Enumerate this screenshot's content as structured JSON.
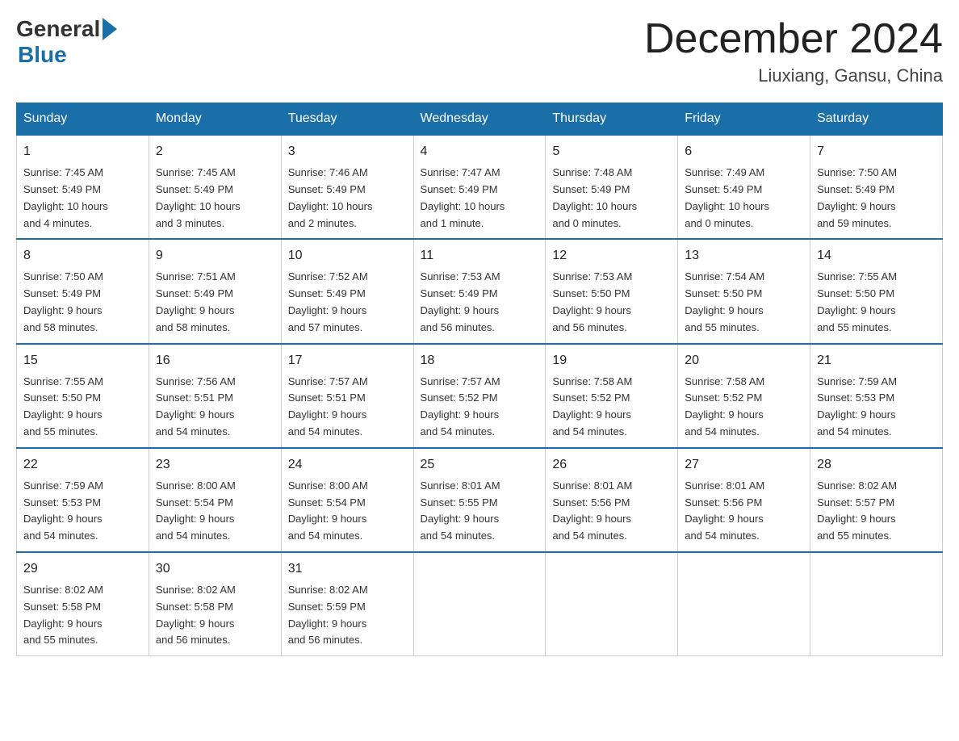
{
  "header": {
    "logo_general": "General",
    "logo_blue": "Blue",
    "month_title": "December 2024",
    "location": "Liuxiang, Gansu, China"
  },
  "weekdays": [
    "Sunday",
    "Monday",
    "Tuesday",
    "Wednesday",
    "Thursday",
    "Friday",
    "Saturday"
  ],
  "weeks": [
    [
      {
        "day": "1",
        "info": "Sunrise: 7:45 AM\nSunset: 5:49 PM\nDaylight: 10 hours\nand 4 minutes."
      },
      {
        "day": "2",
        "info": "Sunrise: 7:45 AM\nSunset: 5:49 PM\nDaylight: 10 hours\nand 3 minutes."
      },
      {
        "day": "3",
        "info": "Sunrise: 7:46 AM\nSunset: 5:49 PM\nDaylight: 10 hours\nand 2 minutes."
      },
      {
        "day": "4",
        "info": "Sunrise: 7:47 AM\nSunset: 5:49 PM\nDaylight: 10 hours\nand 1 minute."
      },
      {
        "day": "5",
        "info": "Sunrise: 7:48 AM\nSunset: 5:49 PM\nDaylight: 10 hours\nand 0 minutes."
      },
      {
        "day": "6",
        "info": "Sunrise: 7:49 AM\nSunset: 5:49 PM\nDaylight: 10 hours\nand 0 minutes."
      },
      {
        "day": "7",
        "info": "Sunrise: 7:50 AM\nSunset: 5:49 PM\nDaylight: 9 hours\nand 59 minutes."
      }
    ],
    [
      {
        "day": "8",
        "info": "Sunrise: 7:50 AM\nSunset: 5:49 PM\nDaylight: 9 hours\nand 58 minutes."
      },
      {
        "day": "9",
        "info": "Sunrise: 7:51 AM\nSunset: 5:49 PM\nDaylight: 9 hours\nand 58 minutes."
      },
      {
        "day": "10",
        "info": "Sunrise: 7:52 AM\nSunset: 5:49 PM\nDaylight: 9 hours\nand 57 minutes."
      },
      {
        "day": "11",
        "info": "Sunrise: 7:53 AM\nSunset: 5:49 PM\nDaylight: 9 hours\nand 56 minutes."
      },
      {
        "day": "12",
        "info": "Sunrise: 7:53 AM\nSunset: 5:50 PM\nDaylight: 9 hours\nand 56 minutes."
      },
      {
        "day": "13",
        "info": "Sunrise: 7:54 AM\nSunset: 5:50 PM\nDaylight: 9 hours\nand 55 minutes."
      },
      {
        "day": "14",
        "info": "Sunrise: 7:55 AM\nSunset: 5:50 PM\nDaylight: 9 hours\nand 55 minutes."
      }
    ],
    [
      {
        "day": "15",
        "info": "Sunrise: 7:55 AM\nSunset: 5:50 PM\nDaylight: 9 hours\nand 55 minutes."
      },
      {
        "day": "16",
        "info": "Sunrise: 7:56 AM\nSunset: 5:51 PM\nDaylight: 9 hours\nand 54 minutes."
      },
      {
        "day": "17",
        "info": "Sunrise: 7:57 AM\nSunset: 5:51 PM\nDaylight: 9 hours\nand 54 minutes."
      },
      {
        "day": "18",
        "info": "Sunrise: 7:57 AM\nSunset: 5:52 PM\nDaylight: 9 hours\nand 54 minutes."
      },
      {
        "day": "19",
        "info": "Sunrise: 7:58 AM\nSunset: 5:52 PM\nDaylight: 9 hours\nand 54 minutes."
      },
      {
        "day": "20",
        "info": "Sunrise: 7:58 AM\nSunset: 5:52 PM\nDaylight: 9 hours\nand 54 minutes."
      },
      {
        "day": "21",
        "info": "Sunrise: 7:59 AM\nSunset: 5:53 PM\nDaylight: 9 hours\nand 54 minutes."
      }
    ],
    [
      {
        "day": "22",
        "info": "Sunrise: 7:59 AM\nSunset: 5:53 PM\nDaylight: 9 hours\nand 54 minutes."
      },
      {
        "day": "23",
        "info": "Sunrise: 8:00 AM\nSunset: 5:54 PM\nDaylight: 9 hours\nand 54 minutes."
      },
      {
        "day": "24",
        "info": "Sunrise: 8:00 AM\nSunset: 5:54 PM\nDaylight: 9 hours\nand 54 minutes."
      },
      {
        "day": "25",
        "info": "Sunrise: 8:01 AM\nSunset: 5:55 PM\nDaylight: 9 hours\nand 54 minutes."
      },
      {
        "day": "26",
        "info": "Sunrise: 8:01 AM\nSunset: 5:56 PM\nDaylight: 9 hours\nand 54 minutes."
      },
      {
        "day": "27",
        "info": "Sunrise: 8:01 AM\nSunset: 5:56 PM\nDaylight: 9 hours\nand 54 minutes."
      },
      {
        "day": "28",
        "info": "Sunrise: 8:02 AM\nSunset: 5:57 PM\nDaylight: 9 hours\nand 55 minutes."
      }
    ],
    [
      {
        "day": "29",
        "info": "Sunrise: 8:02 AM\nSunset: 5:58 PM\nDaylight: 9 hours\nand 55 minutes."
      },
      {
        "day": "30",
        "info": "Sunrise: 8:02 AM\nSunset: 5:58 PM\nDaylight: 9 hours\nand 56 minutes."
      },
      {
        "day": "31",
        "info": "Sunrise: 8:02 AM\nSunset: 5:59 PM\nDaylight: 9 hours\nand 56 minutes."
      },
      {
        "day": "",
        "info": ""
      },
      {
        "day": "",
        "info": ""
      },
      {
        "day": "",
        "info": ""
      },
      {
        "day": "",
        "info": ""
      }
    ]
  ]
}
